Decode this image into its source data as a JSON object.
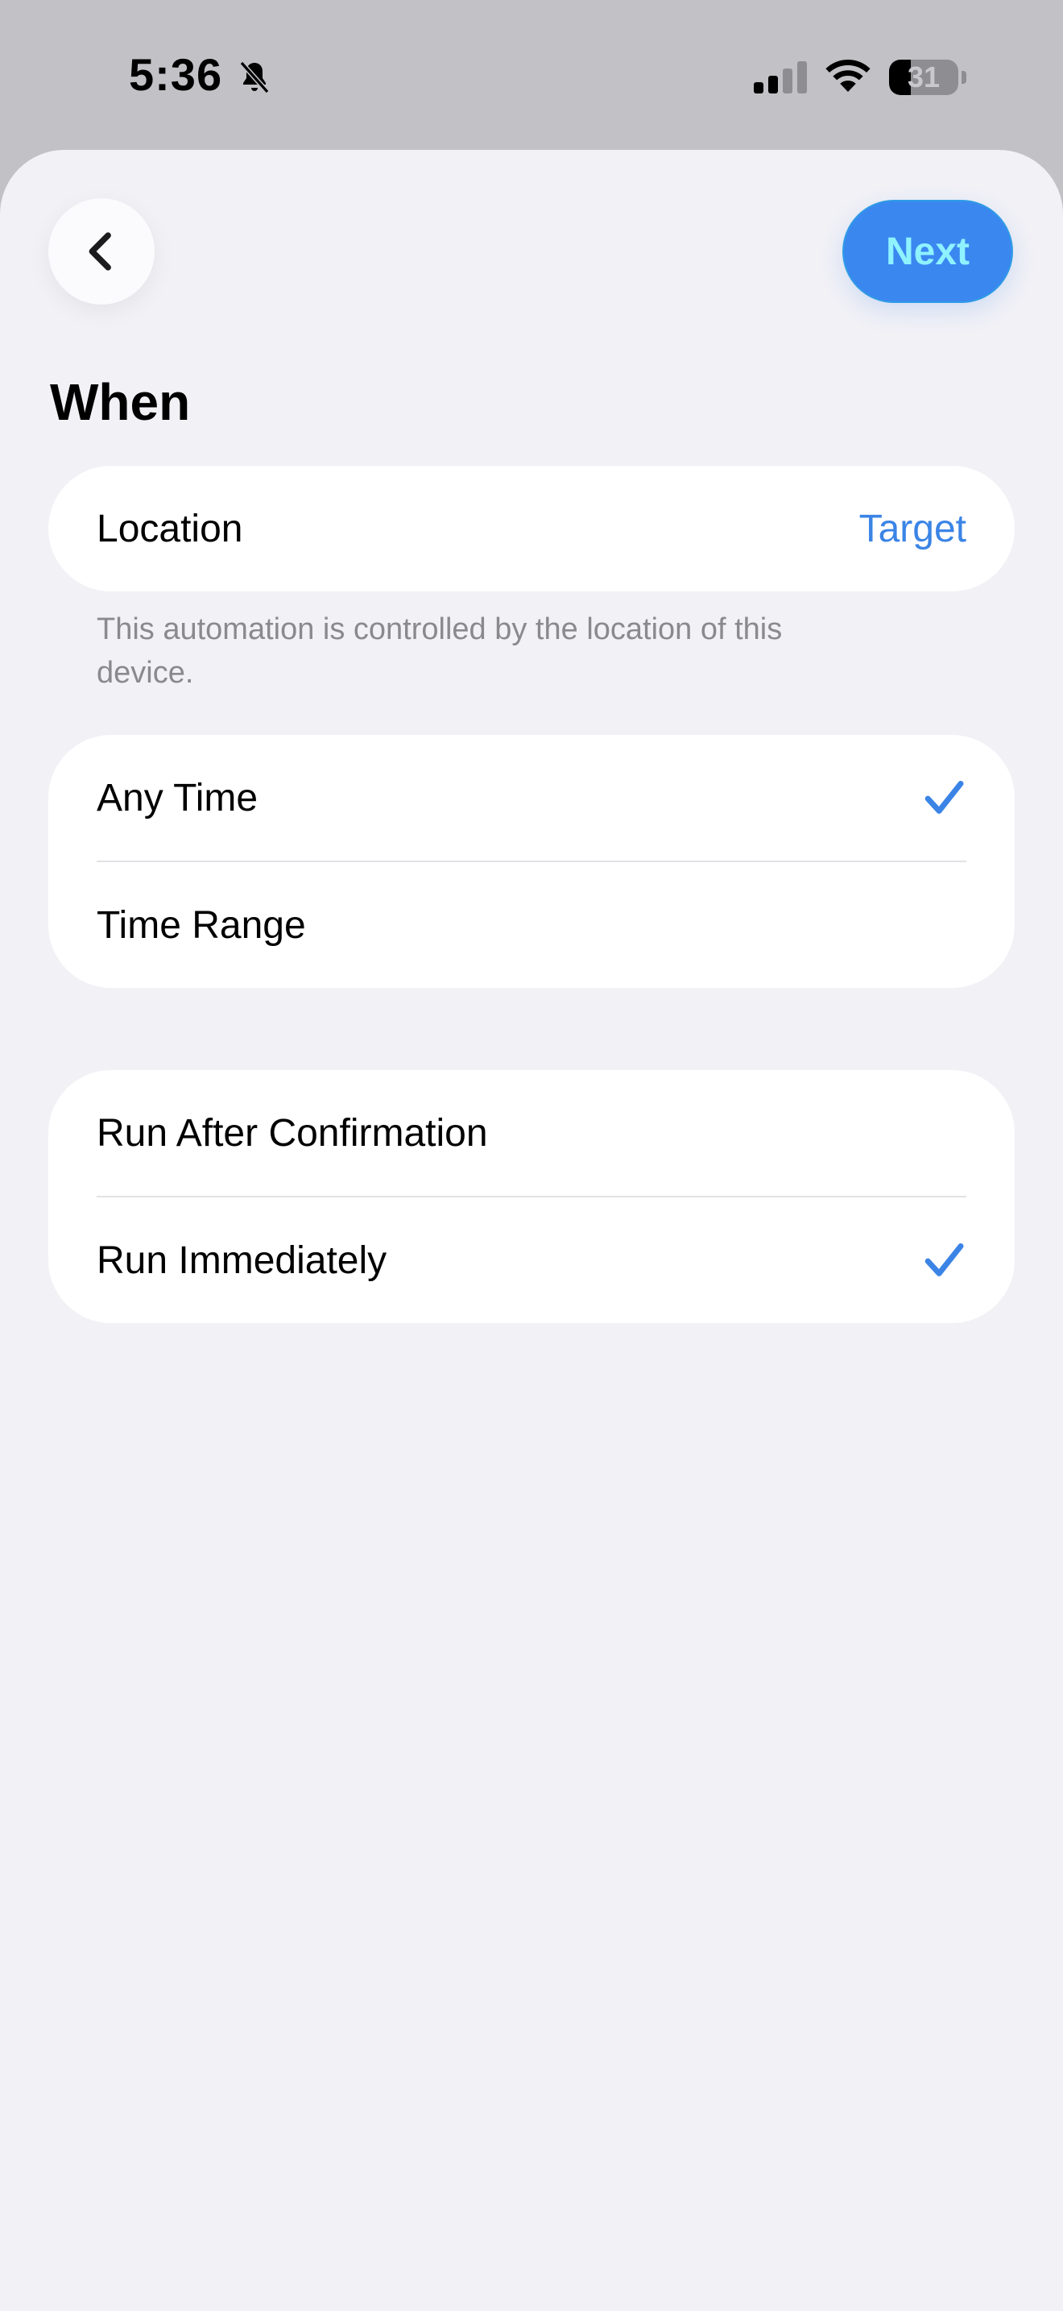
{
  "status_bar": {
    "time": "5:36",
    "battery": "31",
    "battery_level": 0.31,
    "icons": [
      "bell-slash-icon",
      "cellular-signal-icon",
      "wifi-icon",
      "battery-icon"
    ]
  },
  "nav": {
    "back_icon": "chevron-left-icon",
    "next_label": "Next"
  },
  "section": {
    "title": "When"
  },
  "location_card": {
    "label": "Location",
    "value": "Target",
    "footnote": "This automation is controlled by the location of this device."
  },
  "time_card": {
    "rows": [
      {
        "label": "Any Time",
        "checked": true
      },
      {
        "label": "Time Range",
        "checked": false
      }
    ]
  },
  "run_card": {
    "rows": [
      {
        "label": "Run After Confirmation",
        "checked": false
      },
      {
        "label": "Run Immediately",
        "checked": true
      }
    ]
  },
  "colors": {
    "accent": "#3b84e6",
    "next_button_bg": "#3b87f0",
    "next_button_text": "#8ff2ff",
    "sheet_bg": "#f1f1f6",
    "dim_bg": "#c2c1c6"
  }
}
